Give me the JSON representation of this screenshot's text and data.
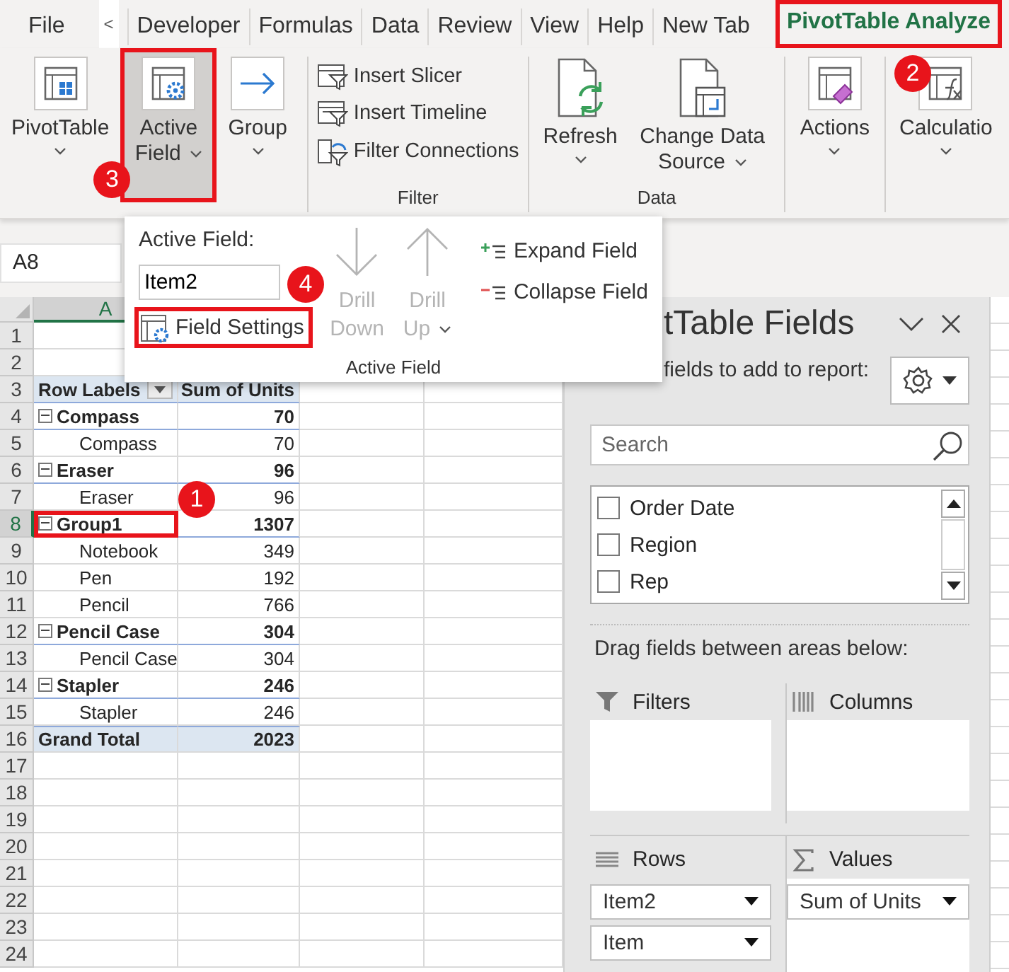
{
  "tabs": [
    {
      "kind": "tab",
      "label": "File",
      "selected": false,
      "highlighted": false
    },
    {
      "kind": "scroll",
      "label": "<",
      "selected": false,
      "highlighted": false
    },
    {
      "kind": "tab",
      "label": "Developer",
      "selected": false,
      "highlighted": false
    },
    {
      "kind": "tab",
      "label": "Formulas",
      "selected": false,
      "highlighted": false
    },
    {
      "kind": "tab",
      "label": "Data",
      "selected": false,
      "highlighted": false
    },
    {
      "kind": "tab",
      "label": "Review",
      "selected": false,
      "highlighted": false
    },
    {
      "kind": "tab",
      "label": "View",
      "selected": false,
      "highlighted": false
    },
    {
      "kind": "tab",
      "label": "Help",
      "selected": false,
      "highlighted": false
    },
    {
      "kind": "tab",
      "label": "New Tab",
      "selected": false,
      "highlighted": false
    },
    {
      "kind": "tab",
      "label": "PivotTable Analyze",
      "selected": true,
      "highlighted": true,
      "callout": "2"
    }
  ],
  "ribbon": {
    "groups": [
      {
        "buttons": [
          {
            "kind": "large",
            "label": "PivotTable",
            "dropdown": true,
            "pressed": false,
            "highlighted": false
          },
          {
            "kind": "large",
            "label": "Active Field",
            "dropdown": true,
            "pressed": true,
            "highlighted": true,
            "callout": "3"
          },
          {
            "kind": "large",
            "label": "Group",
            "dropdown": true,
            "pressed": false,
            "highlighted": false
          }
        ]
      },
      {
        "label": "Filter",
        "buttons": [
          {
            "kind": "small",
            "label": "Insert Slicer",
            "dropdown": false,
            "pressed": false,
            "highlighted": false
          },
          {
            "kind": "small",
            "label": "Insert Timeline",
            "dropdown": false,
            "pressed": false,
            "highlighted": false
          },
          {
            "kind": "small",
            "label": "Filter Connections",
            "dropdown": false,
            "pressed": false,
            "highlighted": false
          }
        ]
      },
      {
        "label": "Data",
        "buttons": [
          {
            "kind": "large",
            "label": "Refresh",
            "dropdown": true,
            "pressed": false,
            "highlighted": false
          },
          {
            "kind": "large",
            "label": "Change Data Source",
            "dropdown": true,
            "pressed": false,
            "highlighted": false
          }
        ]
      },
      {
        "buttons": [
          {
            "kind": "large",
            "label": "Actions",
            "dropdown": true,
            "pressed": false,
            "highlighted": false
          }
        ]
      },
      {
        "buttons": [
          {
            "kind": "large",
            "label": "Calculatio",
            "dropdown": true,
            "pressed": false,
            "highlighted": false
          }
        ]
      }
    ]
  },
  "name_box": "A8",
  "active_field_popup": {
    "field_label": "Active Field:",
    "field_value": "Item2",
    "settings_button": {
      "label": "Field Settings",
      "highlighted": true,
      "callout": "4"
    },
    "drill": [
      {
        "kind": "down",
        "label": "Drill Down",
        "disabled": true,
        "dropdown": false
      },
      {
        "kind": "up",
        "label": "Drill Up",
        "disabled": true,
        "dropdown": true
      }
    ],
    "fold": [
      {
        "kind": "expand",
        "label": "Expand Field"
      },
      {
        "kind": "collapse",
        "label": "Collapse Field"
      }
    ],
    "group_label": "Active Field"
  },
  "sheet": {
    "columns": [
      {
        "label": "A",
        "selected": true
      }
    ],
    "row_numbers": [
      "1",
      "2",
      "3",
      "4",
      "5",
      "6",
      "7",
      "8",
      "9",
      "10",
      "11",
      "12",
      "13",
      "14",
      "15",
      "16",
      "17",
      "18",
      "19",
      "20",
      "21",
      "22",
      "23",
      "24"
    ]
  },
  "pivot": {
    "header": [
      "Row Labels",
      "Sum of Units"
    ],
    "rows": [
      {
        "kind": "group",
        "label": "Compass",
        "value": "70",
        "expanded": true,
        "selected": false,
        "highlighted": false
      },
      {
        "kind": "item",
        "label": "Compass",
        "value": "70",
        "selected": false,
        "highlighted": false
      },
      {
        "kind": "group",
        "label": "Eraser",
        "value": "96",
        "expanded": true,
        "selected": false,
        "highlighted": false
      },
      {
        "kind": "item",
        "label": "Eraser",
        "value": "96",
        "selected": false,
        "highlighted": false
      },
      {
        "kind": "group",
        "label": "Group1",
        "value": "1307",
        "expanded": true,
        "selected": true,
        "highlighted": true,
        "callout": "1"
      },
      {
        "kind": "item",
        "label": "Notebook",
        "value": "349",
        "selected": false,
        "highlighted": false
      },
      {
        "kind": "item",
        "label": "Pen",
        "value": "192",
        "selected": false,
        "highlighted": false
      },
      {
        "kind": "item",
        "label": "Pencil",
        "value": "766",
        "selected": false,
        "highlighted": false
      },
      {
        "kind": "group",
        "label": "Pencil Case",
        "value": "304",
        "expanded": true,
        "selected": false,
        "highlighted": false
      },
      {
        "kind": "item",
        "label": "Pencil Case",
        "value": "304",
        "selected": false,
        "highlighted": false
      },
      {
        "kind": "group",
        "label": "Stapler",
        "value": "246",
        "expanded": true,
        "selected": false,
        "highlighted": false
      },
      {
        "kind": "item",
        "label": "Stapler",
        "value": "246",
        "selected": false,
        "highlighted": false
      },
      {
        "kind": "total",
        "label": "Grand Total",
        "value": "2023",
        "selected": false,
        "highlighted": false
      }
    ]
  },
  "fields_pane": {
    "title": "tTable Fields",
    "subtitle": "fields to add to report:",
    "search": {
      "placeholder": "Search"
    },
    "fields": [
      {
        "label": "Order Date",
        "checked": false
      },
      {
        "label": "Region",
        "checked": false
      },
      {
        "label": "Rep",
        "checked": false
      }
    ],
    "drag_hint": "Drag fields between areas below:",
    "areas": [
      {
        "kind": "filters",
        "label": "Filters"
      },
      {
        "kind": "columns",
        "label": "Columns"
      },
      {
        "kind": "rows",
        "label": "Rows",
        "fields": [
          "Item2",
          "Item"
        ]
      },
      {
        "kind": "values",
        "label": "Values",
        "fields": [
          "Sum of Units"
        ]
      }
    ]
  }
}
